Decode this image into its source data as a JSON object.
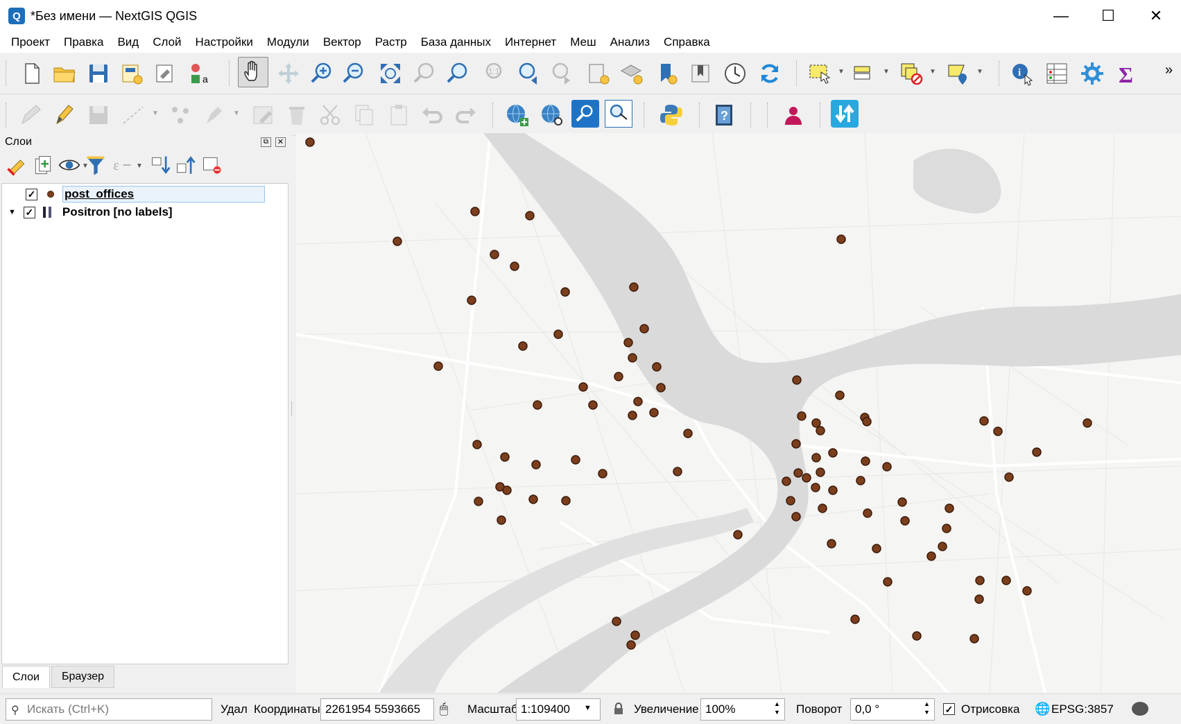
{
  "window": {
    "title": "*Без имени — NextGIS QGIS",
    "logo_letter": "Q",
    "minimize": "—",
    "maximize": "☐",
    "close": "✕"
  },
  "menu": [
    "Проект",
    "Правка",
    "Вид",
    "Слой",
    "Настройки",
    "Модули",
    "Вектор",
    "Растр",
    "База данных",
    "Интернет",
    "Меш",
    "Анализ",
    "Справка"
  ],
  "toolbar_overflow": "»",
  "layers_panel": {
    "title": "Слои",
    "layers": [
      {
        "name": "post_offices",
        "checked": true,
        "symbol": "point"
      },
      {
        "name": "Positron [no labels]",
        "checked": true,
        "symbol": "raster"
      }
    ],
    "tabs": [
      "Слои",
      "Браузер"
    ]
  },
  "status": {
    "search_placeholder": "Искать (Ctrl+K)",
    "udal_label": "Удал",
    "coordinates_label": "Координаты",
    "coordinates_value": "2261954  5593665",
    "scale_label": "Масштаб",
    "scale_value": "1:109400",
    "magnify_label": "Увеличение",
    "magnify_value": "100%",
    "rotation_label": "Поворот",
    "rotation_value": "0,0 °",
    "render_label": "Отрисовка",
    "render_checked": true,
    "crs": "EPSG:3857"
  },
  "colors": {
    "point_fill": "#7b3f1e",
    "point_stroke": "#3a1a08",
    "accent": "#1e6fb9",
    "river": "#dcdcdc"
  }
}
